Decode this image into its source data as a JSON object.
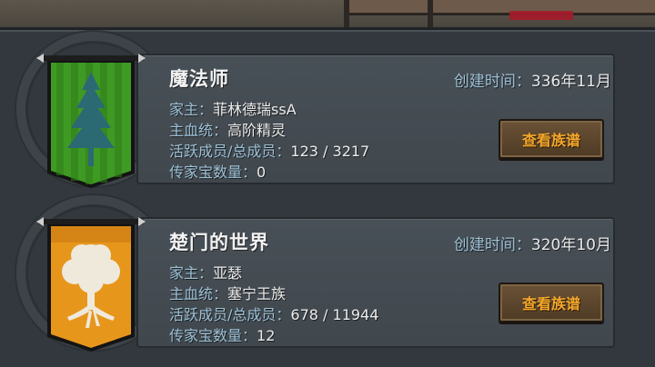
{
  "families": [
    {
      "name": "魔法师",
      "created_label": "创建时间：",
      "created_value": "336年11月",
      "head_label": "家主：",
      "head_value": "菲林德瑞ssA",
      "bloodline_label": "主血统：",
      "bloodline_value": "高阶精灵",
      "members_label": "活跃成员/总成员：",
      "members_value": "123 / 3217",
      "heirloom_label": "传家宝数量：",
      "heirloom_value": "0",
      "button_label": "查看族谱",
      "banner": {
        "color": "#3f9a24",
        "stripe": "#2f7d18",
        "emblem": "pine-tree-icon",
        "emblem_color": "#2b6a73"
      }
    },
    {
      "name": "楚门的世界",
      "created_label": "创建时间：",
      "created_value": "320年10月",
      "head_label": "家主：",
      "head_value": "亚瑟",
      "bloodline_label": "主血统：",
      "bloodline_value": "塞宁王族",
      "members_label": "活跃成员/总成员：",
      "members_value": "678 / 11944",
      "heirloom_label": "传家宝数量：",
      "heirloom_value": "12",
      "button_label": "查看族谱",
      "banner": {
        "color": "#e7961c",
        "stripe": "#c97a10",
        "emblem": "white-tree-icon",
        "emblem_color": "#efe9dc"
      }
    }
  ]
}
